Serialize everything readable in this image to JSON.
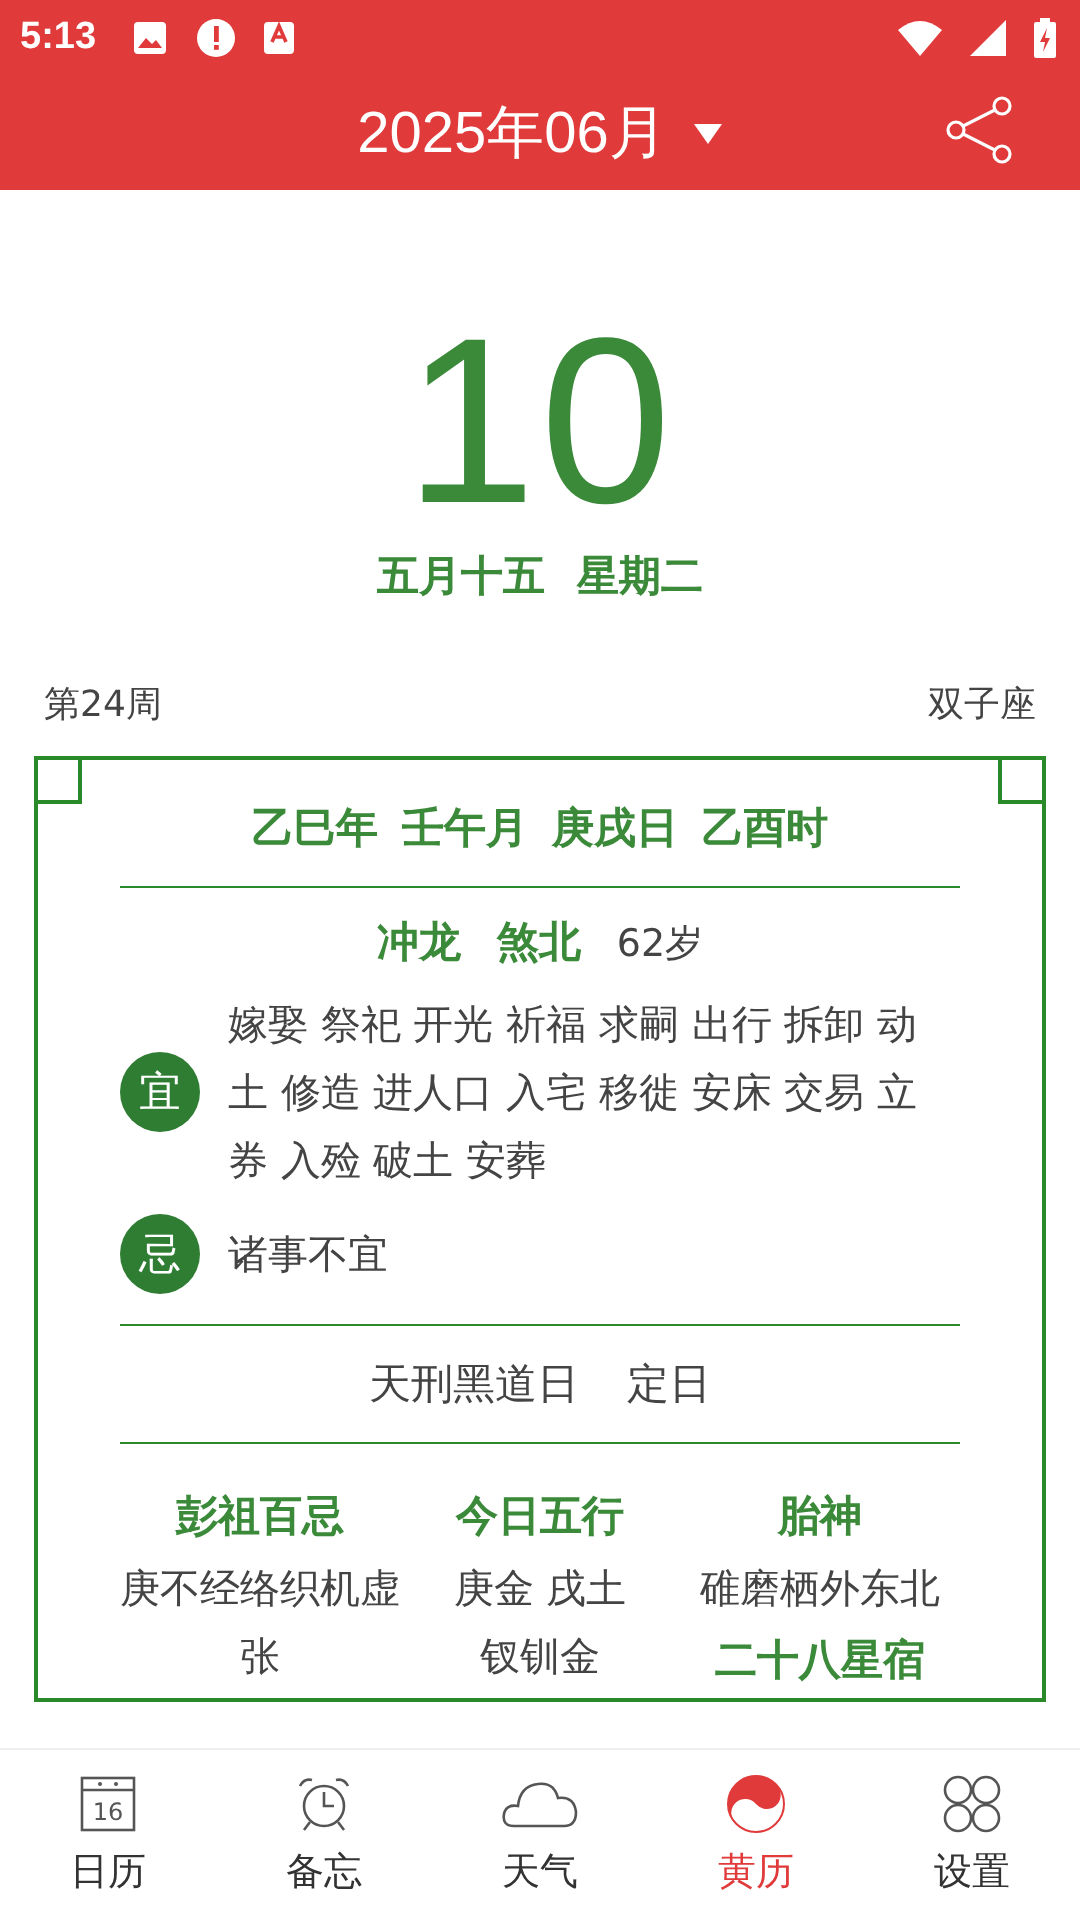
{
  "status_bar": {
    "time": "5:13"
  },
  "header": {
    "title": "2025年06月"
  },
  "day": {
    "number": "10",
    "lunar": "五月十五",
    "weekday": "星期二"
  },
  "week": "第24周",
  "zodiac": "双子座",
  "ganzhi": [
    "乙巳年",
    "壬午月",
    "庚戌日",
    "乙酉时"
  ],
  "clash": {
    "chong": "冲龙",
    "sha": "煞北",
    "age": "62岁"
  },
  "advice": [
    {
      "badge": "宜",
      "text": "嫁娶 祭祀 开光 祈福 求嗣 出行 拆卸 动土 修造 进人口 入宅 移徙 安床 交易 立券 入殓 破土 安葬"
    },
    {
      "badge": "忌",
      "text": "诸事不宜"
    }
  ],
  "day_info": [
    "天刑黑道日",
    "定日"
  ],
  "columns": [
    [
      {
        "heading": "彭祖百忌",
        "lines": [
          "庚不经络织机虚张"
        ]
      }
    ],
    [
      {
        "heading": "今日五行",
        "lines": [
          "庚金 戌土",
          "钗钏金"
        ]
      }
    ],
    [
      {
        "heading": "胎神",
        "lines": [
          "碓磨栖外东北"
        ]
      },
      {
        "heading": "二十八星宿"
      }
    ]
  ],
  "nav": [
    {
      "kind": "calendar",
      "label": "日历",
      "icon_text": "16",
      "selected": false
    },
    {
      "kind": "alarm",
      "label": "备忘",
      "selected": false
    },
    {
      "kind": "weather",
      "label": "天气",
      "selected": false
    },
    {
      "kind": "almanac",
      "label": "黄历",
      "selected": true
    },
    {
      "kind": "settings",
      "label": "设置",
      "selected": false
    }
  ]
}
